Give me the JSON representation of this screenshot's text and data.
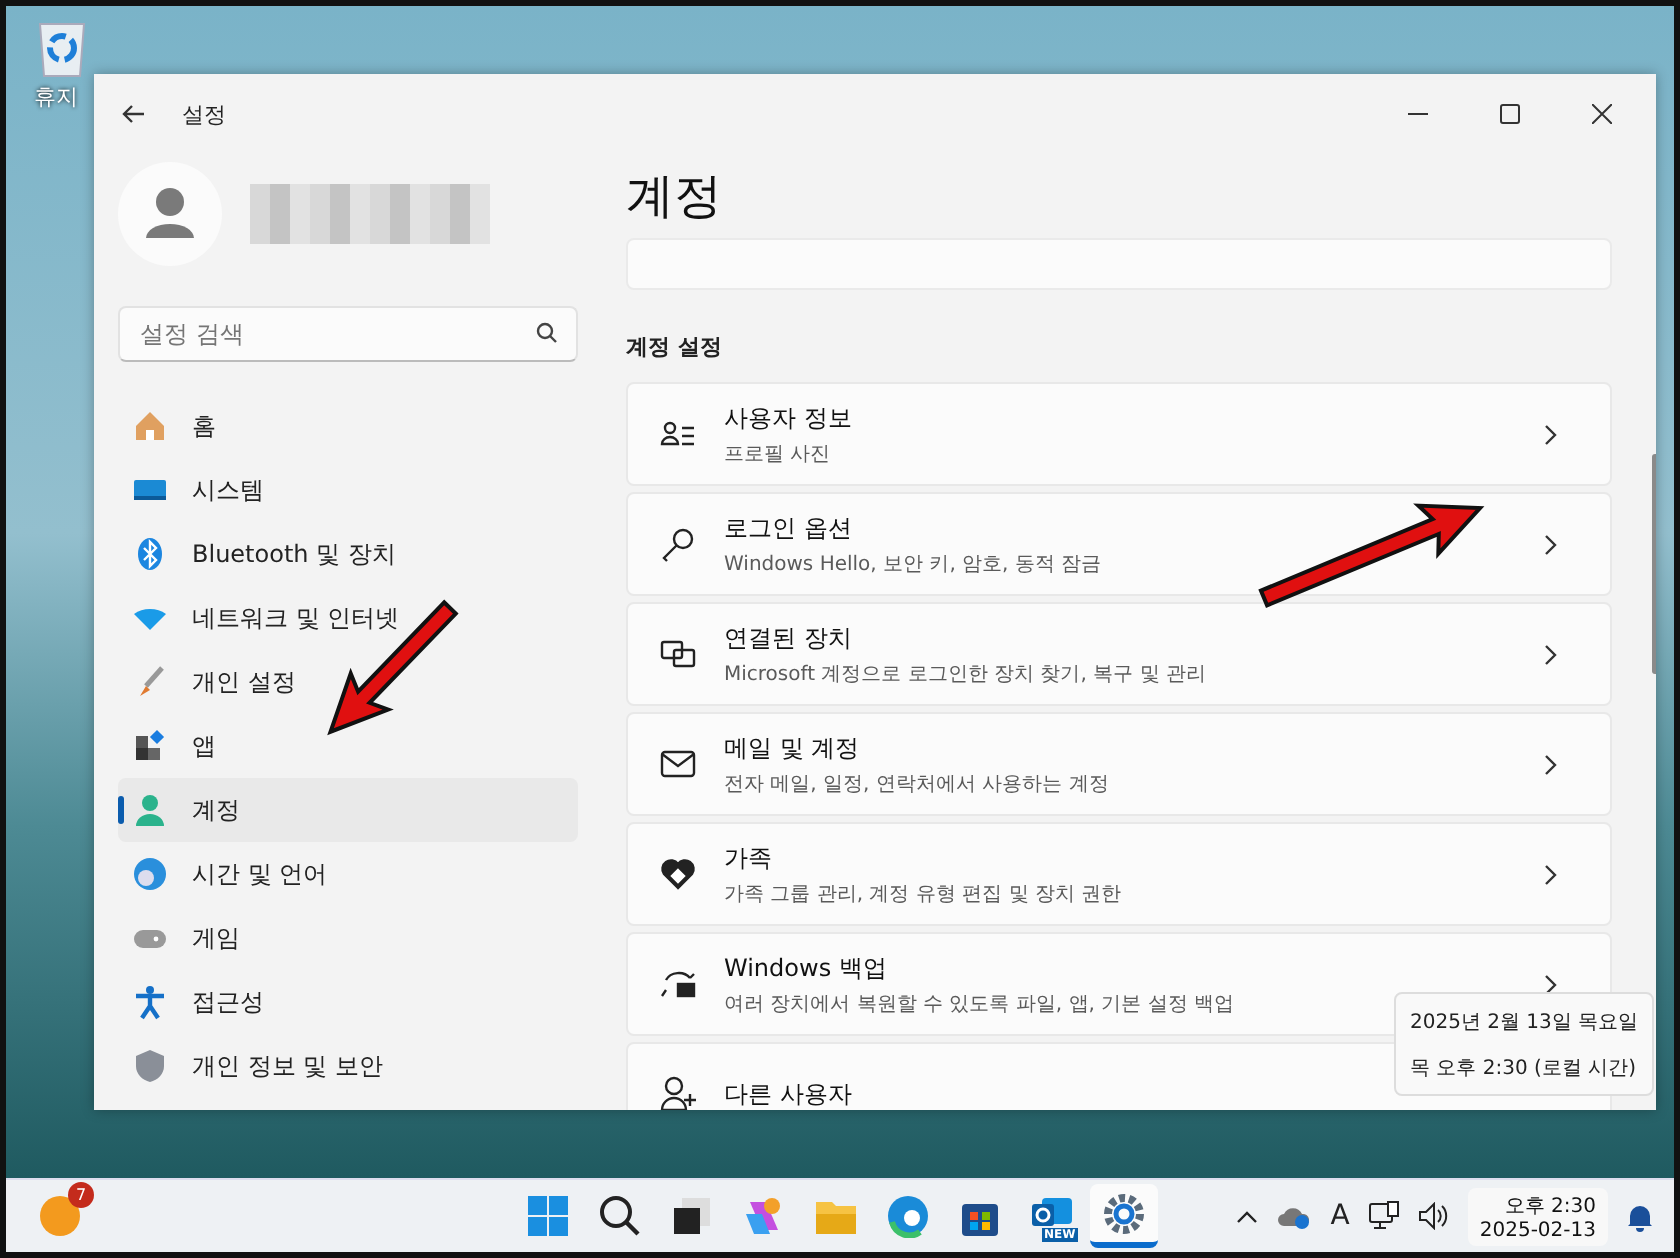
{
  "desktop": {
    "icons": [
      {
        "label": "휴지"
      }
    ]
  },
  "window": {
    "title": "설정"
  },
  "sidebar": {
    "search": {
      "placeholder": "설정 검색"
    },
    "items": [
      {
        "label": "홈",
        "kind": "home",
        "selected": false
      },
      {
        "label": "시스템",
        "kind": "system",
        "selected": false
      },
      {
        "label": "Bluetooth 및 장치",
        "kind": "bluetooth",
        "selected": false
      },
      {
        "label": "네트워크 및 인터넷",
        "kind": "network",
        "selected": false
      },
      {
        "label": "개인 설정",
        "kind": "brush",
        "selected": false
      },
      {
        "label": "앱",
        "kind": "apps",
        "selected": false
      },
      {
        "label": "계정",
        "kind": "account",
        "selected": true
      },
      {
        "label": "시간 및 언어",
        "kind": "time",
        "selected": false
      },
      {
        "label": "게임",
        "kind": "game",
        "selected": false
      },
      {
        "label": "접근성",
        "kind": "access",
        "selected": false
      },
      {
        "label": "개인 정보 및 보안",
        "kind": "shield",
        "selected": false
      }
    ]
  },
  "page": {
    "title": "계정",
    "section": "계정 설정",
    "cards": [
      {
        "title": "사용자 정보",
        "subtitle": "프로필 사진",
        "kind": "userinfo"
      },
      {
        "title": "로그인 옵션",
        "subtitle": "Windows Hello, 보안 키, 암호, 동적 잠금",
        "kind": "key"
      },
      {
        "title": "연결된 장치",
        "subtitle": "Microsoft 계정으로 로그인한 장치 찾기, 복구 및 관리",
        "kind": "devices"
      },
      {
        "title": "메일 및 계정",
        "subtitle": "전자 메일, 일정, 연락처에서 사용하는 계정",
        "kind": "mail"
      },
      {
        "title": "가족",
        "subtitle": "가족 그룹 관리, 계정 유형 편집 및 장치 권한",
        "kind": "family"
      },
      {
        "title": "Windows 백업",
        "subtitle": "여러 장치에서 복원할 수 있도록 파일, 앱, 기본 설정 백업",
        "kind": "backup"
      },
      {
        "title": "다른 사용자",
        "kind": "others"
      }
    ]
  },
  "tooltip": {
    "lines": [
      "2025년 2월 13일 목요일",
      "목 오후 2:30 (로컬 시간)"
    ]
  },
  "taskbar": {
    "widget_badge": "7",
    "apps": [
      {
        "kind": "start",
        "active": false
      },
      {
        "kind": "search",
        "active": false
      },
      {
        "kind": "taskview",
        "active": false
      },
      {
        "kind": "copilot",
        "active": false
      },
      {
        "kind": "folder",
        "active": false
      },
      {
        "kind": "edge",
        "active": false
      },
      {
        "kind": "store",
        "active": false
      },
      {
        "kind": "outlook",
        "active": false,
        "tag": "NEW"
      },
      {
        "kind": "settings",
        "active": true
      }
    ],
    "tray_letter": "A",
    "clock": {
      "time": "오후 2:30",
      "date": "2025-02-13"
    }
  }
}
